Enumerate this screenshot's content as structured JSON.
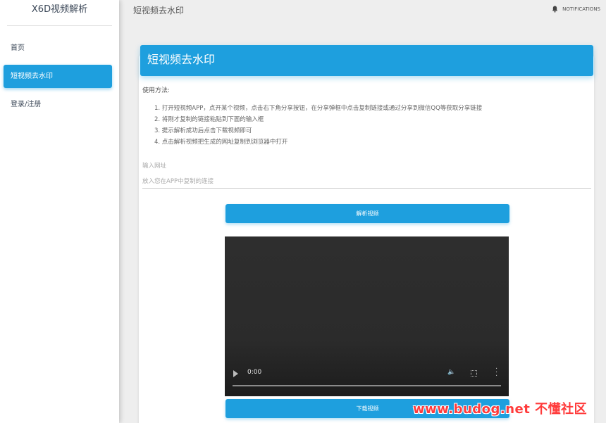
{
  "sidebar": {
    "brand": "X6D视频解析",
    "items": [
      {
        "label": "首页",
        "active": false
      },
      {
        "label": "短视频去水印",
        "active": true
      },
      {
        "label": "登录/注册",
        "active": false
      }
    ]
  },
  "topbar": {
    "title": "短视频去水印",
    "notifications_label": "NOTIFICATIONS",
    "notifications_icon": "bell-icon"
  },
  "card": {
    "title": "短视频去水印",
    "usage_title": "使用方法:",
    "steps": [
      "1. 打开短视频APP，点开某个视频，点击右下角分享按钮，在分享弹框中点击复制链接或通过分享到微信QQ等获取分享链接",
      "2. 将刚才复制的链接粘贴到下面的输入框",
      "3. 提示解析成功后点击下载视频即可",
      "4. 点击解析视频把生成的网址复制到浏览器中打开"
    ],
    "input_label": "输入网址",
    "input_placeholder": "放入您在APP中复制的连接",
    "input_value": "",
    "parse_button": "解析视频",
    "download_button": "下载视频"
  },
  "video": {
    "time": "0:00",
    "progress": 0
  },
  "watermark": "www.budog.net 不懂社区",
  "colors": {
    "accent": "#1e9fde",
    "background": "#eeeeee",
    "watermark": "#ff3b3b"
  }
}
